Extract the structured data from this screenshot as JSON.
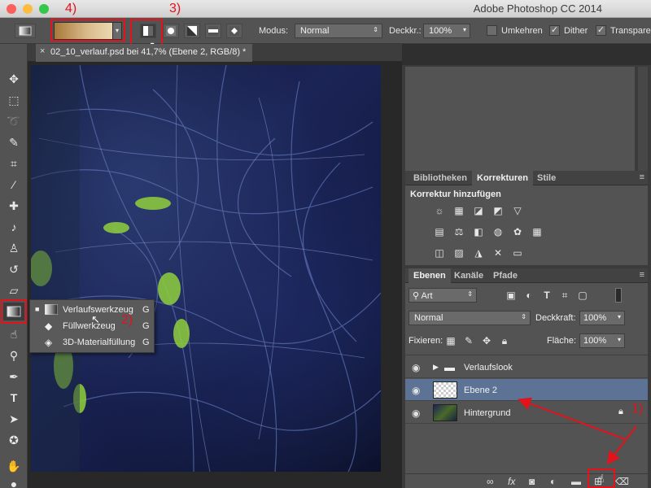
{
  "titlebar": {
    "app_title": "Adobe Photoshop CC 2014",
    "close_color": "#fc605c",
    "min_color": "#fdbc40",
    "max_color": "#34c84a"
  },
  "options": {
    "modus_label": "Modus:",
    "modus_value": "Normal",
    "deckkr_label": "Deckkr.:",
    "deckkr_value": "100%",
    "umkehren_label": "Umkehren",
    "dither_label": "Dither",
    "transparenz_label": "Transparenz",
    "umkehren_checked": false,
    "dither_checked": true,
    "transparenz_checked": true,
    "gradient_colors": [
      "#a8783a",
      "#d9bb8b",
      "#f0e0bc"
    ]
  },
  "annotations": {
    "a1": "1)",
    "a2": "2)",
    "a3": "3)",
    "a4": "4)",
    "color": "#e3121b"
  },
  "document": {
    "tab_label": "02_10_verlauf.psd bei 41,7% (Ebene 2, RGB/8) *"
  },
  "flyout": {
    "items": [
      {
        "label": "Verlaufswerkzeug",
        "key": "G",
        "selected": true
      },
      {
        "label": "Füllwerkzeug",
        "key": "G",
        "selected": false
      },
      {
        "label": "3D-Materialfüllung",
        "key": "G",
        "selected": false
      }
    ]
  },
  "panels": {
    "adjust_tabs": [
      "Bibliotheken",
      "Korrekturen",
      "Stile"
    ],
    "adjust_title": "Korrektur hinzufügen",
    "layer_tabs": [
      "Ebenen",
      "Kanäle",
      "Pfade"
    ],
    "filter_value": "Art",
    "blend_value": "Normal",
    "deckkraft_label": "Deckkraft:",
    "deckkraft_value": "100%",
    "fixieren_label": "Fixieren:",
    "flaeche_label": "Fläche:",
    "flaeche_value": "100%",
    "layers": [
      {
        "name": "Verlaufslook",
        "type": "group",
        "selected": false
      },
      {
        "name": "Ebene 2",
        "type": "empty",
        "selected": true
      },
      {
        "name": "Hintergrund",
        "type": "image",
        "selected": false
      }
    ],
    "selection_color": "#5d7396"
  }
}
